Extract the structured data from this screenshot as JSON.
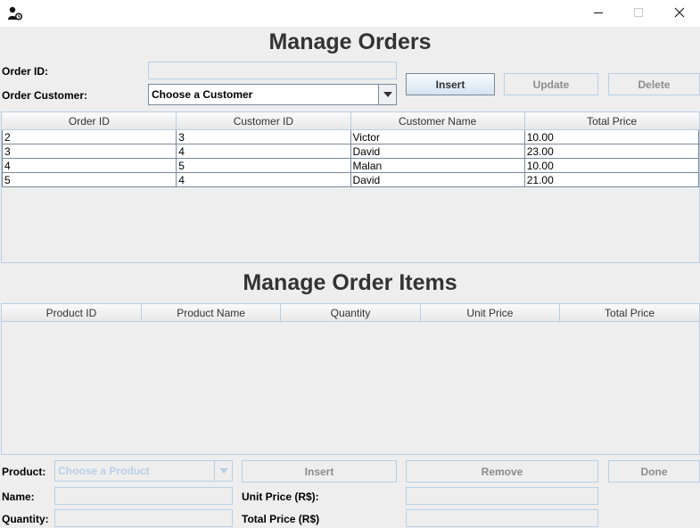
{
  "window": {
    "minimize_glyph": "—",
    "maximize_glyph": "☐",
    "close_glyph": "✕"
  },
  "orders": {
    "title": "Manage Orders",
    "order_id_label": "Order ID:",
    "order_id_value": "",
    "customer_label": "Order Customer:",
    "customer_selected": "Choose a Customer",
    "buttons": {
      "insert": "Insert",
      "update": "Update",
      "delete": "Delete"
    },
    "columns": [
      "Order ID",
      "Customer ID",
      "Customer Name",
      "Total Price"
    ],
    "rows": [
      [
        "2",
        "3",
        "Victor",
        "10.00"
      ],
      [
        "3",
        "4",
        "David",
        "23.00"
      ],
      [
        "4",
        "5",
        "Malan",
        "10.00"
      ],
      [
        "5",
        "4",
        "David",
        "21.00"
      ]
    ]
  },
  "items": {
    "title": "Manage Order Items",
    "columns": [
      "Product ID",
      "Product Name",
      "Quantity",
      "Unit Price",
      "Total Price"
    ],
    "rows": [],
    "product_label": "Product:",
    "product_selected": "Choose a Product",
    "buttons": {
      "insert": "Insert",
      "remove": "Remove",
      "done": "Done"
    },
    "name_label": "Name:",
    "quantity_label": "Quantity:",
    "unit_price_label": "Unit Price (R$):",
    "total_price_label": "Total Price (R$)",
    "name_value": "",
    "quantity_value": "",
    "unit_price_value": "",
    "total_price_value": ""
  },
  "colors": {
    "accent_border": "#b8cfe5",
    "background": "#eeeeee",
    "title_text": "#333333"
  }
}
